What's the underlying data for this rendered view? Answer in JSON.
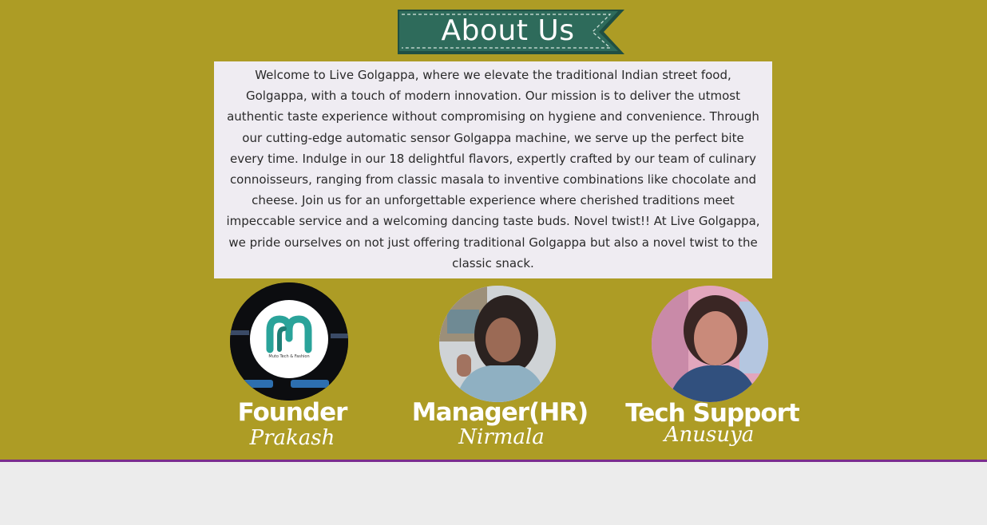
{
  "heading": "About Us",
  "about_text": "Welcome to Live Golgappa, where we elevate the traditional Indian street food, Golgappa, with a touch of modern innovation. Our mission is to deliver the utmost authentic taste experience without compromising on hygiene and convenience. Through our cutting-edge automatic sensor Golgappa machine, we serve up the perfect bite every time. Indulge in our 18 delightful flavors, expertly crafted by our team of culinary connoisseurs, ranging from classic masala to inventive combinations like chocolate and cheese. Join us for an unforgettable experience where cherished traditions meet impeccable service and a welcoming dancing taste buds. Novel twist!! At Live Golgappa, we pride ourselves on not just offering traditional Golgappa but also a novel twist to the classic snack.",
  "team": [
    {
      "role": "Founder",
      "name": "Prakash",
      "logo_caption": "Muto Tech & Fashion"
    },
    {
      "role": "Manager(HR)",
      "name": "Nirmala"
    },
    {
      "role": "Tech Support",
      "name": "Anusuya"
    }
  ],
  "colors": {
    "background": "#ad9c25",
    "ribbon": "#2e6b5b",
    "text_box": "#efecf2",
    "divider": "#7b2d8e",
    "logo_teal": "#2aa39a"
  }
}
